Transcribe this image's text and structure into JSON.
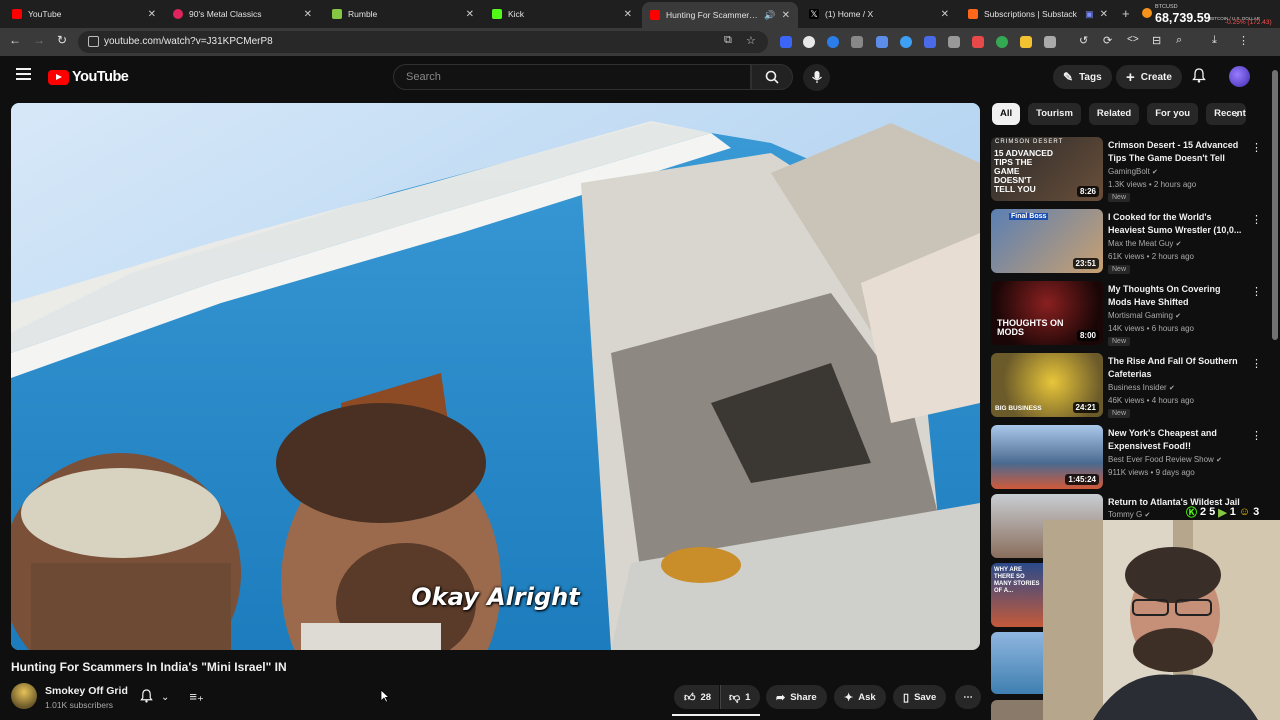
{
  "browser": {
    "tabs": [
      {
        "label": "YouTube",
        "color": "#ff0000"
      },
      {
        "label": "90's Metal Classics",
        "color": "#e0245e"
      },
      {
        "label": "Rumble",
        "color": "#85c742"
      },
      {
        "label": "Kick",
        "color": "#53fc18"
      },
      {
        "label": "Hunting For Scammers In Ind",
        "color": "#ff0000",
        "active": true
      },
      {
        "label": "(1) Home / X",
        "color": "#ffffff"
      },
      {
        "label": "Subscriptions | Substack",
        "color": "#ff6719"
      }
    ],
    "url": "youtube.com/watch?v=J31KPCMerP8",
    "ticker": {
      "symbol": "BTCUSD",
      "subtitle": "BITCOIN / U.S. DOLLAR",
      "price": "68,739.59",
      "change": "-0.25% (172.43)"
    }
  },
  "youtube": {
    "logo_text": "YouTube",
    "search_placeholder": "Search",
    "tags_label": "Tags",
    "create_label": "Create"
  },
  "video": {
    "caption": "Okay Alright",
    "title": "Hunting For Scammers In India's \"Mini Israel\" IN",
    "channel": "Smokey Off Grid",
    "subscribers": "1.01K subscribers",
    "likes": "28",
    "dislikes": "1",
    "share_label": "Share",
    "ask_label": "Ask",
    "save_label": "Save"
  },
  "sidebar": {
    "chips": [
      "All",
      "Tourism",
      "Related",
      "For you",
      "Recent"
    ],
    "recommendations": [
      {
        "title": "Crimson Desert - 15 Advanced Tips The Game Doesn't Tell You",
        "channel": "GamingBolt",
        "meta": "1.3K views • 2 hours ago",
        "badge": "New",
        "duration": "8:26",
        "thumb_text": "15 ADVANCED TIPS THE GAME DOESN'T TELL YOU",
        "thumb_top": "CRIMSON DESERT"
      },
      {
        "title": "I Cooked for the World's Heaviest Sumo Wrestler (10,0...",
        "channel": "Max the Meat Guy",
        "meta": "61K views • 2 hours ago",
        "badge": "New",
        "duration": "23:51",
        "thumb_text": "Final Boss"
      },
      {
        "title": "My Thoughts On Covering Mods Have Shifted",
        "channel": "Mortismal Gaming",
        "meta": "14K views • 6 hours ago",
        "badge": "New",
        "duration": "8:00",
        "thumb_text": "THOUGHTS ON MODS"
      },
      {
        "title": "The Rise And Fall Of Southern Cafeterias",
        "channel": "Business Insider",
        "meta": "46K views • 4 hours ago",
        "badge": "New",
        "duration": "24:21",
        "thumb_text": "BIG BUSINESS"
      },
      {
        "title": "New York's Cheapest and Expensivest Food!!",
        "channel": "Best Ever Food Review Show",
        "meta": "911K views • 9 days ago",
        "badge": "",
        "duration": "1:45:24",
        "thumb_text": ""
      },
      {
        "title": "Return to Atlanta's Wildest Jail",
        "channel": "Tommy G",
        "meta": "",
        "badge": "",
        "duration": "",
        "thumb_text": ""
      }
    ],
    "partial_thumbs": [
      "WHY ARE THERE SO MANY STORIES OF A...",
      "",
      ""
    ]
  },
  "overlay": {
    "chat_kick": "2",
    "chat_youtube": "5",
    "chat_rumble": "1",
    "chat_emoji": "3"
  }
}
